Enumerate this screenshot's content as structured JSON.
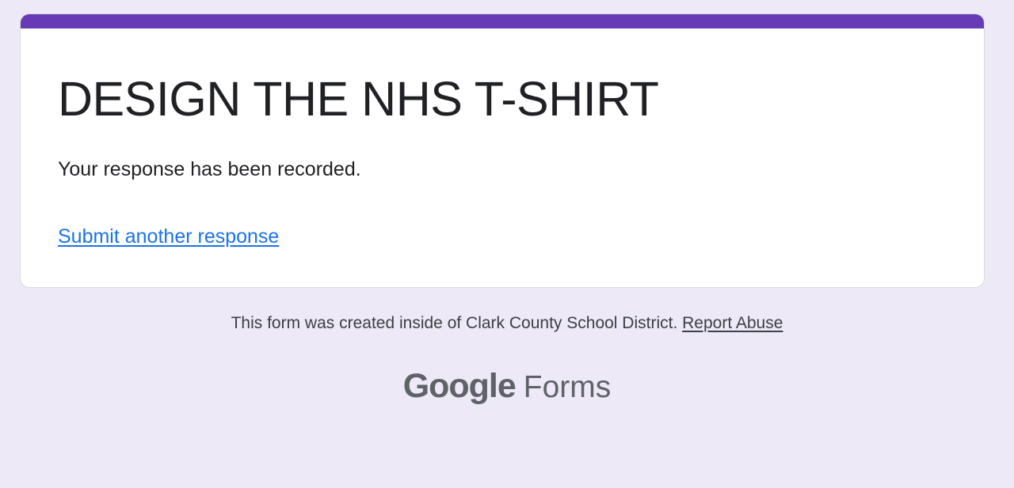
{
  "form": {
    "title": "DESIGN THE NHS T-SHIRT",
    "confirmation_message": "Your response has been recorded.",
    "submit_another_label": "Submit another response"
  },
  "footer": {
    "notice": "This form was created inside of Clark County School District.",
    "report_abuse_label": "Report Abuse"
  },
  "branding": {
    "google": "Google",
    "product": "Forms"
  },
  "colors": {
    "page_background": "#ede9f6",
    "accent": "#673ab7",
    "link": "#1a73e8",
    "text_primary": "#202124",
    "text_secondary": "#3c4043",
    "brand_gray": "#5f6368"
  }
}
